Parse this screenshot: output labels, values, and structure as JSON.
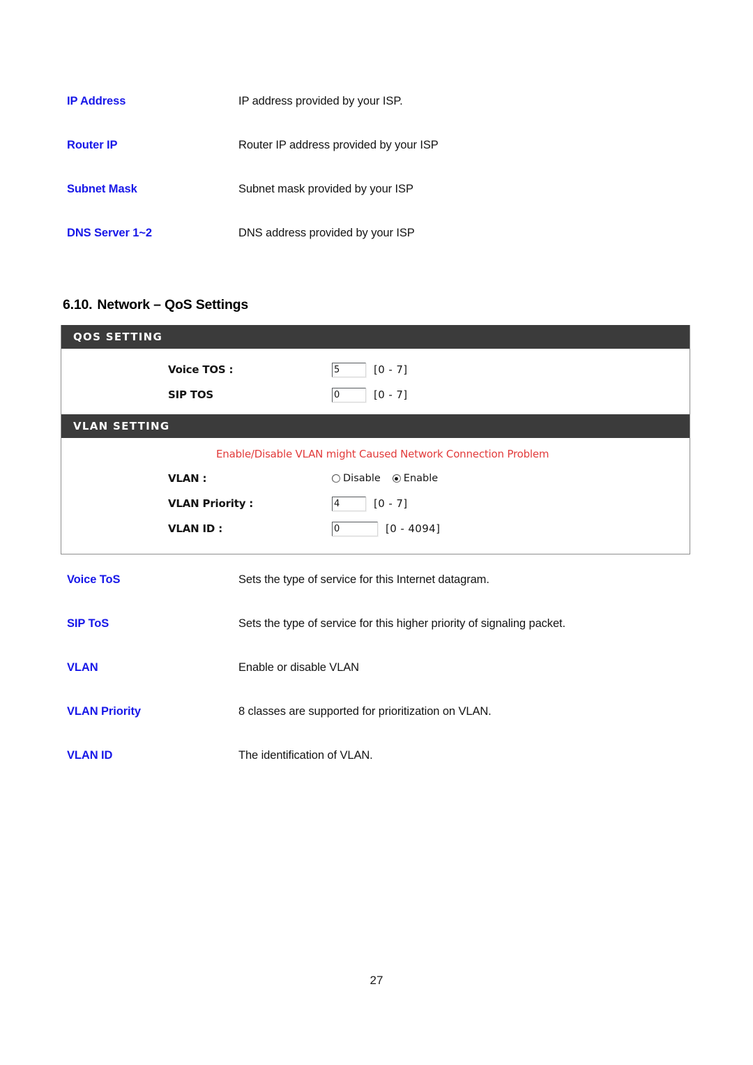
{
  "top_descriptions": [
    {
      "label": "IP Address",
      "text": "IP address provided by your ISP."
    },
    {
      "label": "Router IP",
      "text": "Router IP address provided by your ISP"
    },
    {
      "label": "Subnet Mask",
      "text": "Subnet mask provided by your ISP"
    },
    {
      "label": "DNS Server 1~2",
      "text": "DNS address provided by your ISP"
    }
  ],
  "heading": {
    "number": "6.10.",
    "title": "Network – QoS Settings"
  },
  "qos_panel": {
    "header": "QOS SETTING",
    "fields": [
      {
        "label": "Voice TOS :",
        "value": "5",
        "hint": "[0 - 7]"
      },
      {
        "label": "SIP TOS",
        "value": "0",
        "hint": "[0 - 7]"
      }
    ]
  },
  "vlan_panel": {
    "header": "VLAN SETTING",
    "warning": "Enable/Disable VLAN might Caused Network Connection Problem",
    "vlan_label": "VLAN :",
    "radios": [
      {
        "label": "Disable",
        "checked": false
      },
      {
        "label": "Enable",
        "checked": true
      }
    ],
    "fields": [
      {
        "label": "VLAN Priority :",
        "value": "4",
        "hint": "[0 - 7]"
      },
      {
        "label": "VLAN ID :",
        "value": "0",
        "hint": "[0 - 4094]"
      }
    ]
  },
  "bottom_descriptions": [
    {
      "label": "Voice ToS",
      "text": "Sets the type of service for this Internet datagram."
    },
    {
      "label": "SIP ToS",
      "text": "Sets the type of service for this higher priority of signaling packet."
    },
    {
      "label": "VLAN",
      "text": "Enable or disable VLAN"
    },
    {
      "label": "VLAN Priority",
      "text": "8 classes are supported for prioritization on VLAN."
    },
    {
      "label": "VLAN ID",
      "text": "The identification of VLAN."
    }
  ],
  "page_number": "27",
  "colors": {
    "label_blue": "#1818e8",
    "warning_red": "#e23b3b",
    "panel_header_bg": "#3b3b3b"
  }
}
